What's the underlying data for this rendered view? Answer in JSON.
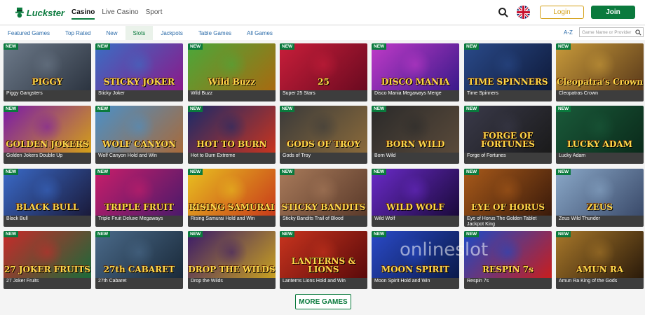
{
  "brand": {
    "name": "Luckster",
    "accent": "#0a7a3d",
    "login_color": "#d4a017"
  },
  "mainnav": [
    {
      "label": "Casino",
      "active": true
    },
    {
      "label": "Live Casino",
      "active": false
    },
    {
      "label": "Sport",
      "active": false
    }
  ],
  "header": {
    "login_label": "Login",
    "join_label": "Join",
    "search_icon": "search-icon",
    "language": "uk-flag-icon"
  },
  "subnav": {
    "tabs": [
      "Featured Games",
      "Top Rated",
      "New",
      "Slots",
      "Jackpots",
      "Table Games",
      "All Games"
    ],
    "active_tab": "Slots",
    "az_label": "A-Z",
    "search_placeholder": "Game Name or Provider"
  },
  "badge_label": "NEW",
  "games": [
    {
      "name": "Piggy Gangsters",
      "art": "PIGGY",
      "c1": "#6d7a8a",
      "c2": "#2c3440"
    },
    {
      "name": "Sticky Joker",
      "art": "STICKY JOKER",
      "c1": "#3a6ec4",
      "c2": "#8a1a8a"
    },
    {
      "name": "Wild Buzz",
      "art": "Wild Buzz",
      "c1": "#4aa83a",
      "c2": "#a86a10"
    },
    {
      "name": "Super 25 Stars",
      "art": "25",
      "c1": "#c81e3a",
      "c2": "#6a0a20"
    },
    {
      "name": "Disco Mania Megaways Merge",
      "art": "DISCO MANIA",
      "c1": "#c03ac8",
      "c2": "#3a1a8a"
    },
    {
      "name": "Time Spinners",
      "art": "TIME SPINNERS",
      "c1": "#2a4a8a",
      "c2": "#0e1a3a"
    },
    {
      "name": "Cleopatras Crown",
      "art": "Cleopatra's Crown",
      "c1": "#c89a3a",
      "c2": "#5a3a1a"
    },
    {
      "name": "Golden Jokers Double Up",
      "art": "GOLDEN JOKERS",
      "c1": "#7a1aa8",
      "c2": "#d4a017"
    },
    {
      "name": "Wolf Canyon Hold and Win",
      "art": "WOLF CANYON",
      "c1": "#4a90c8",
      "c2": "#a86a3a"
    },
    {
      "name": "Hot to Burn Extreme",
      "art": "HOT TO BURN",
      "c1": "#1a2a6a",
      "c2": "#c8341e"
    },
    {
      "name": "Gods of Troy",
      "art": "GODS OF TROY",
      "c1": "#3a3a3a",
      "c2": "#8a6a3a"
    },
    {
      "name": "Born Wild",
      "art": "BORN WILD",
      "c1": "#2a2a2a",
      "c2": "#5a4a3a"
    },
    {
      "name": "Forge of Fortunes",
      "art": "FORGE OF FORTUNES",
      "c1": "#3a3a4a",
      "c2": "#1a1a1a"
    },
    {
      "name": "Lucky Adam",
      "art": "LUCKY ADAM",
      "c1": "#1a5a3a",
      "c2": "#0a2a1a"
    },
    {
      "name": "Black Bull",
      "art": "BLACK BULL",
      "c1": "#3a6ac8",
      "c2": "#1a1a3a"
    },
    {
      "name": "Triple Fruit Deluxe Megaways",
      "art": "TRIPLE FRUIT",
      "c1": "#c81e6a",
      "c2": "#4a1a6a"
    },
    {
      "name": "Rising Samurai Hold and Win",
      "art": "RISING SAMURAI",
      "c1": "#e8c020",
      "c2": "#c83a1a"
    },
    {
      "name": "Sticky Bandits Trail of Blood",
      "art": "STICKY BANDITS",
      "c1": "#a87a5a",
      "c2": "#5a3a2a"
    },
    {
      "name": "Wild Wolf",
      "art": "WILD WOLF",
      "c1": "#6a2ac8",
      "c2": "#1a0a3a"
    },
    {
      "name": "Eye of Horus The Golden Tablet Jackpot King",
      "art": "EYE OF HORUS",
      "c1": "#a85a1a",
      "c2": "#3a1a0a"
    },
    {
      "name": "Zeus Wild Thunder",
      "art": "ZEUS",
      "c1": "#8aa8c8",
      "c2": "#3a4a6a"
    },
    {
      "name": "27 Joker Fruits",
      "art": "27 JOKER FRUITS",
      "c1": "#c82a2a",
      "c2": "#1a6a3a"
    },
    {
      "name": "27th Cabaret",
      "art": "27th CABARET",
      "c1": "#4a6a8a",
      "c2": "#1a2a3a"
    },
    {
      "name": "Drop the Wilds",
      "art": "DROP THE WILDS",
      "c1": "#3a1a6a",
      "c2": "#c8a020"
    },
    {
      "name": "Lanterns Lions Hold and Win",
      "art": "LANTERNS & LIONS",
      "c1": "#c8341e",
      "c2": "#5a0a0a"
    },
    {
      "name": "Moon Spirit Hold and Win",
      "art": "MOON SPIRIT",
      "c1": "#2a4ac8",
      "c2": "#0a1a4a"
    },
    {
      "name": "Respin 7s",
      "art": "RESPIN 7s",
      "c1": "#1a4ac8",
      "c2": "#c81e1e"
    },
    {
      "name": "Amun Ra King of the Gods",
      "art": "AMUN RA",
      "c1": "#a8782a",
      "c2": "#2a1a0a"
    }
  ],
  "more_label": "MORE GAMES",
  "watermark": "onlineslot"
}
